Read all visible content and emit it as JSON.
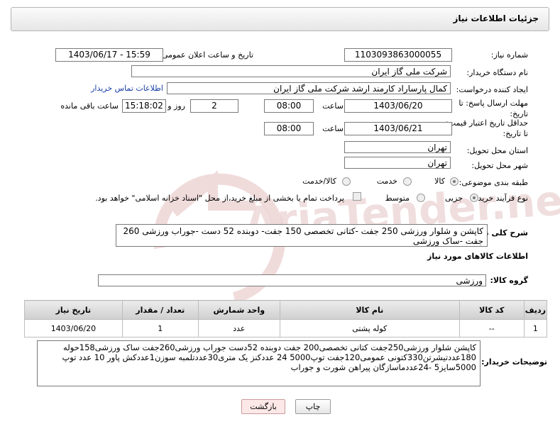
{
  "header": {
    "title": "جزئیات اطلاعات نیاز"
  },
  "form": {
    "need_number_label": "شماره نیاز:",
    "need_number": "1103093863000055",
    "announce_label": "تاریخ و ساعت اعلان عمومی:",
    "announce_value": "1403/06/17 - 15:59",
    "buyer_org_label": "نام دستگاه خریدار:",
    "buyer_org": "شرکت ملی گاز ایران",
    "creator_label": "ایجاد کننده درخواست:",
    "creator": "کمال پارساراد کارمند ارشد شرکت ملی گاز ایران",
    "contact_link": "اطلاعات تماس خریدار",
    "deadline_label": "مهلت ارسال پاسخ: تا تاریخ:",
    "deadline_date": "1403/06/20",
    "time_label": "ساعت",
    "deadline_time": "08:00",
    "days_value": "2",
    "days_label": "روز و",
    "remaining_time": "15:18:02",
    "remaining_label": "ساعت باقی مانده",
    "validity_label": "حداقل تاریخ اعتبار قیمت: تا تاریخ:",
    "validity_date": "1403/06/21",
    "validity_time": "08:00",
    "province_label": "استان محل تحویل:",
    "province": "تهران",
    "city_label": "شهر محل تحویل:",
    "city": "تهران",
    "category_label": "طبقه بندی موضوعی:",
    "category_options": [
      "کالا",
      "خدمت",
      "کالا/خدمت"
    ],
    "process_label": "نوع فرآیند خرید :",
    "process_options": [
      "جزیی",
      "متوسط"
    ],
    "payment_note": "پرداخت تمام یا بخشی از مبلغ خرید،از محل \"اسناد خزانه اسلامی\" خواهد بود.",
    "summary_label": "شرح کلی نیاز:",
    "summary": "کاپشن و شلوار ورزشی 250 جفت -کتانی تخصصی 150 جفت- دوبنده 52 دست -جوراب ورزشی 260 جفت -ساک ورزشی"
  },
  "goods": {
    "section_title": "اطلاعات کالاهای مورد نیاز",
    "group_label": "گروه کالا:",
    "group_value": "ورزشی",
    "columns": [
      "ردیف",
      "کد کالا",
      "نام کالا",
      "واحد شمارش",
      "تعداد / مقدار",
      "تاریخ نیاز"
    ],
    "rows": [
      [
        "1",
        "--",
        "کوله پشتی",
        "عدد",
        "1",
        "1403/06/20"
      ]
    ]
  },
  "buyer_notes": {
    "label": "توضیحات خریدار:",
    "text": "کاپشن شلوار ورزشی250جفت کتانی تخصصی200 جفت دوبنده 52دست جوراب ورزشی260جفت ساک ورزشی158حوله 180عددتیشرتن330کتونی عمومی120جفت توپ5000 24 عددکنز یک متری30عددتلمبه سوزن1عددکش پاور 10 عدد توپ 5000سایز5 -24عددماسازگان پیراهن شورت و جوراب"
  },
  "buttons": {
    "print": "چاپ",
    "back": "بازگشت"
  },
  "watermark": {
    "text": "AriaTender.net",
    "color": "#e8c9c9"
  }
}
